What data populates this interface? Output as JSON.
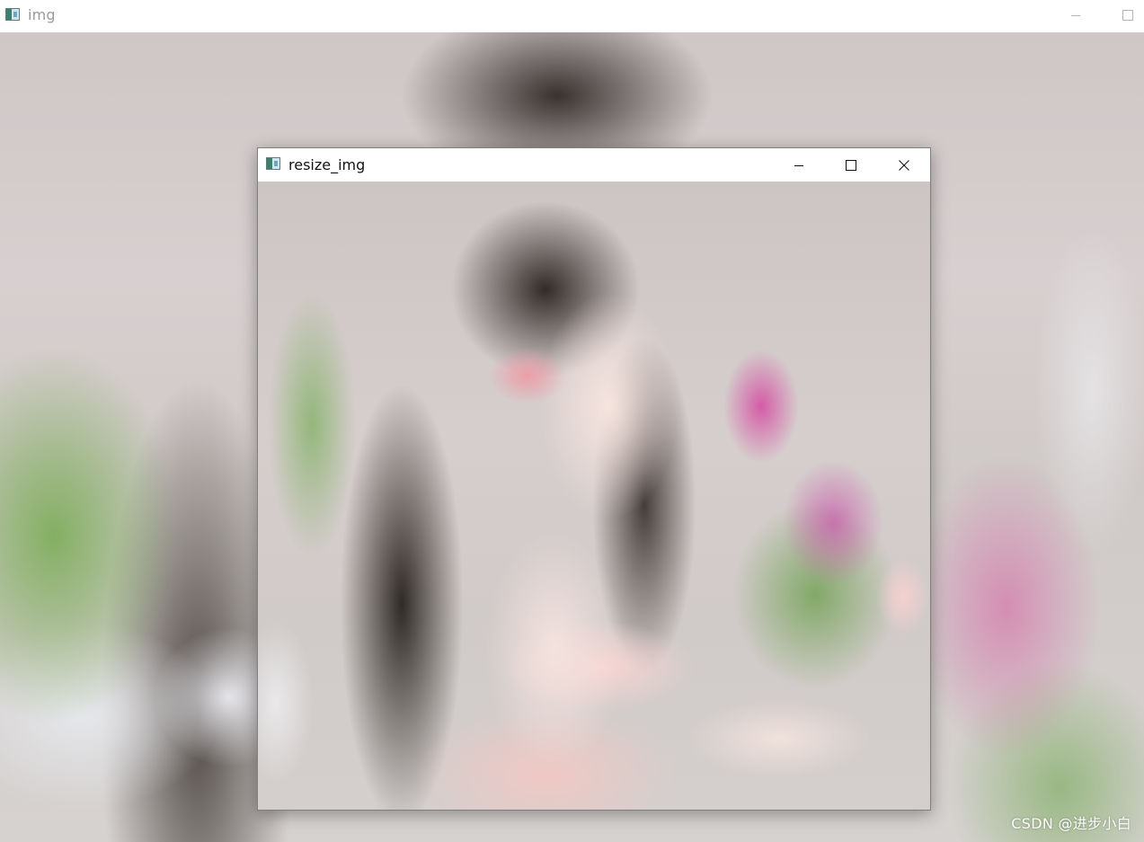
{
  "main_window": {
    "title": "img",
    "controls": {
      "minimize_icon": "minimize-icon",
      "maximize_icon": "maximize-icon"
    },
    "canvas": {
      "content": "image"
    }
  },
  "resize_window": {
    "title": "resize_img",
    "controls": {
      "minimize_icon": "minimize-icon",
      "maximize_icon": "maximize-icon",
      "close_icon": "close-icon"
    },
    "canvas": {
      "content": "image"
    }
  },
  "watermark": "CSDN @进步小白",
  "colors": {
    "titlebar_bg": "#ffffff",
    "main_title_text": "#9a9a9a",
    "resize_title_text": "#111111",
    "window_border": "#7f7f7f"
  }
}
